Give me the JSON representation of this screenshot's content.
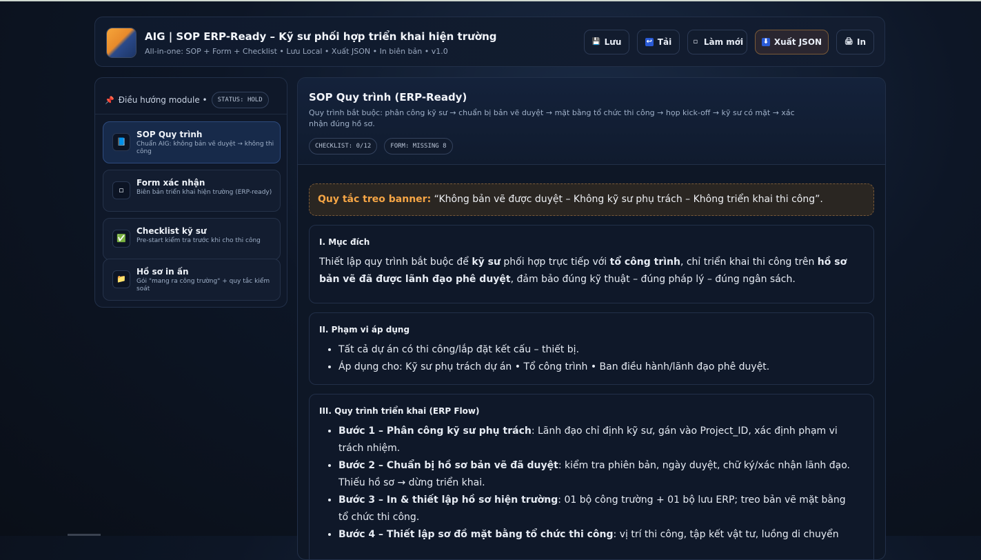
{
  "app": {
    "title": "AIG | SOP ERP-Ready – Kỹ sư phối hợp triển khai hiện trường",
    "subtitle": "All-in-one: SOP + Form + Checklist • Lưu Local • Xuất JSON • In biên bản • v1.0"
  },
  "toolbar": {
    "save": {
      "icon": "💾",
      "label": "Lưu"
    },
    "load": {
      "icon": "↩",
      "label": "Tải"
    },
    "refresh": {
      "icon": "▫",
      "label": "Làm mới"
    },
    "export": {
      "icon": "⬇",
      "label": "Xuất JSON"
    },
    "print": {
      "icon": "🖨",
      "label": "In"
    }
  },
  "sidebar": {
    "pin_icon": "📌",
    "heading": "Điều hướng module •",
    "status": "STATUS: HOLD",
    "modules": [
      {
        "icon": "📘",
        "title": "SOP Quy trình",
        "desc": "Chuẩn AIG: không bản vẽ duyệt → không thi công"
      },
      {
        "icon": "▫",
        "title": "Form xác nhận",
        "desc": "Biên bản triển khai hiện trường (ERP-ready)"
      },
      {
        "icon": "✅",
        "title": "Checklist kỹ sư",
        "desc": "Pre-start kiểm tra trước khi cho thi công"
      },
      {
        "icon": "📁",
        "title": "Hồ sơ in ấn",
        "desc": "Gói \"mang ra công trường\" + quy tắc kiểm soát"
      }
    ]
  },
  "main": {
    "title": "SOP Quy trình (ERP-Ready)",
    "desc": "Quy trình bắt buộc: phân công kỹ sư → chuẩn bị bản vẽ duyệt → mặt bằng tổ chức thi công → họp kick-off → kỹ sư có mặt → xác nhận đúng hồ sơ.",
    "checklist_pill": "CHECKLIST: 0/12",
    "form_pill": "FORM: MISSING 8",
    "banner": {
      "label": "Quy tắc treo banner:",
      "text": " “Không bản vẽ được duyệt – Không kỹ sư phụ trách – Không triển khai thi công”."
    },
    "section1": {
      "title": "I. Mục đích",
      "p1": "Thiết lập quy trình bắt buộc để ",
      "b1": "kỹ sư",
      "p2": " phối hợp trực tiếp với ",
      "b2": "tổ công trình",
      "p3": ", chỉ triển khai thi công trên ",
      "b3": "hồ sơ bản vẽ đã được lãnh đạo phê duyệt",
      "p4": ", đảm bảo đúng kỹ thuật – đúng pháp lý – đúng ngân sách."
    },
    "section2": {
      "title": "II. Phạm vi áp dụng",
      "items": [
        "Tất cả dự án có thi công/lắp đặt kết cấu – thiết bị.",
        "Áp dụng cho: Kỹ sư phụ trách dự án • Tổ công trình • Ban điều hành/lãnh đạo phê duyệt."
      ]
    },
    "section3": {
      "title": "III. Quy trình triển khai (ERP Flow)",
      "steps": [
        {
          "bold": "Bước 1 – Phân công kỹ sư phụ trách",
          "text": ": Lãnh đạo chỉ định kỹ sư, gán vào Project_ID, xác định phạm vi trách nhiệm."
        },
        {
          "bold": "Bước 2 – Chuẩn bị hồ sơ bản vẽ đã duyệt",
          "text": ": kiểm tra phiên bản, ngày duyệt, chữ ký/xác nhận lãnh đạo. Thiếu hồ sơ → dừng triển khai."
        },
        {
          "bold": "Bước 3 – In & thiết lập hồ sơ hiện trường",
          "text": ": 01 bộ công trường + 01 bộ lưu ERP; treo bản vẽ mặt bằng tổ chức thi công."
        },
        {
          "bold": "Bước 4 – Thiết lập sơ đồ mặt bằng tổ chức thi công",
          "text": ": vị trí thi công, tập kết vật tư, luồng di chuyển"
        }
      ]
    }
  }
}
